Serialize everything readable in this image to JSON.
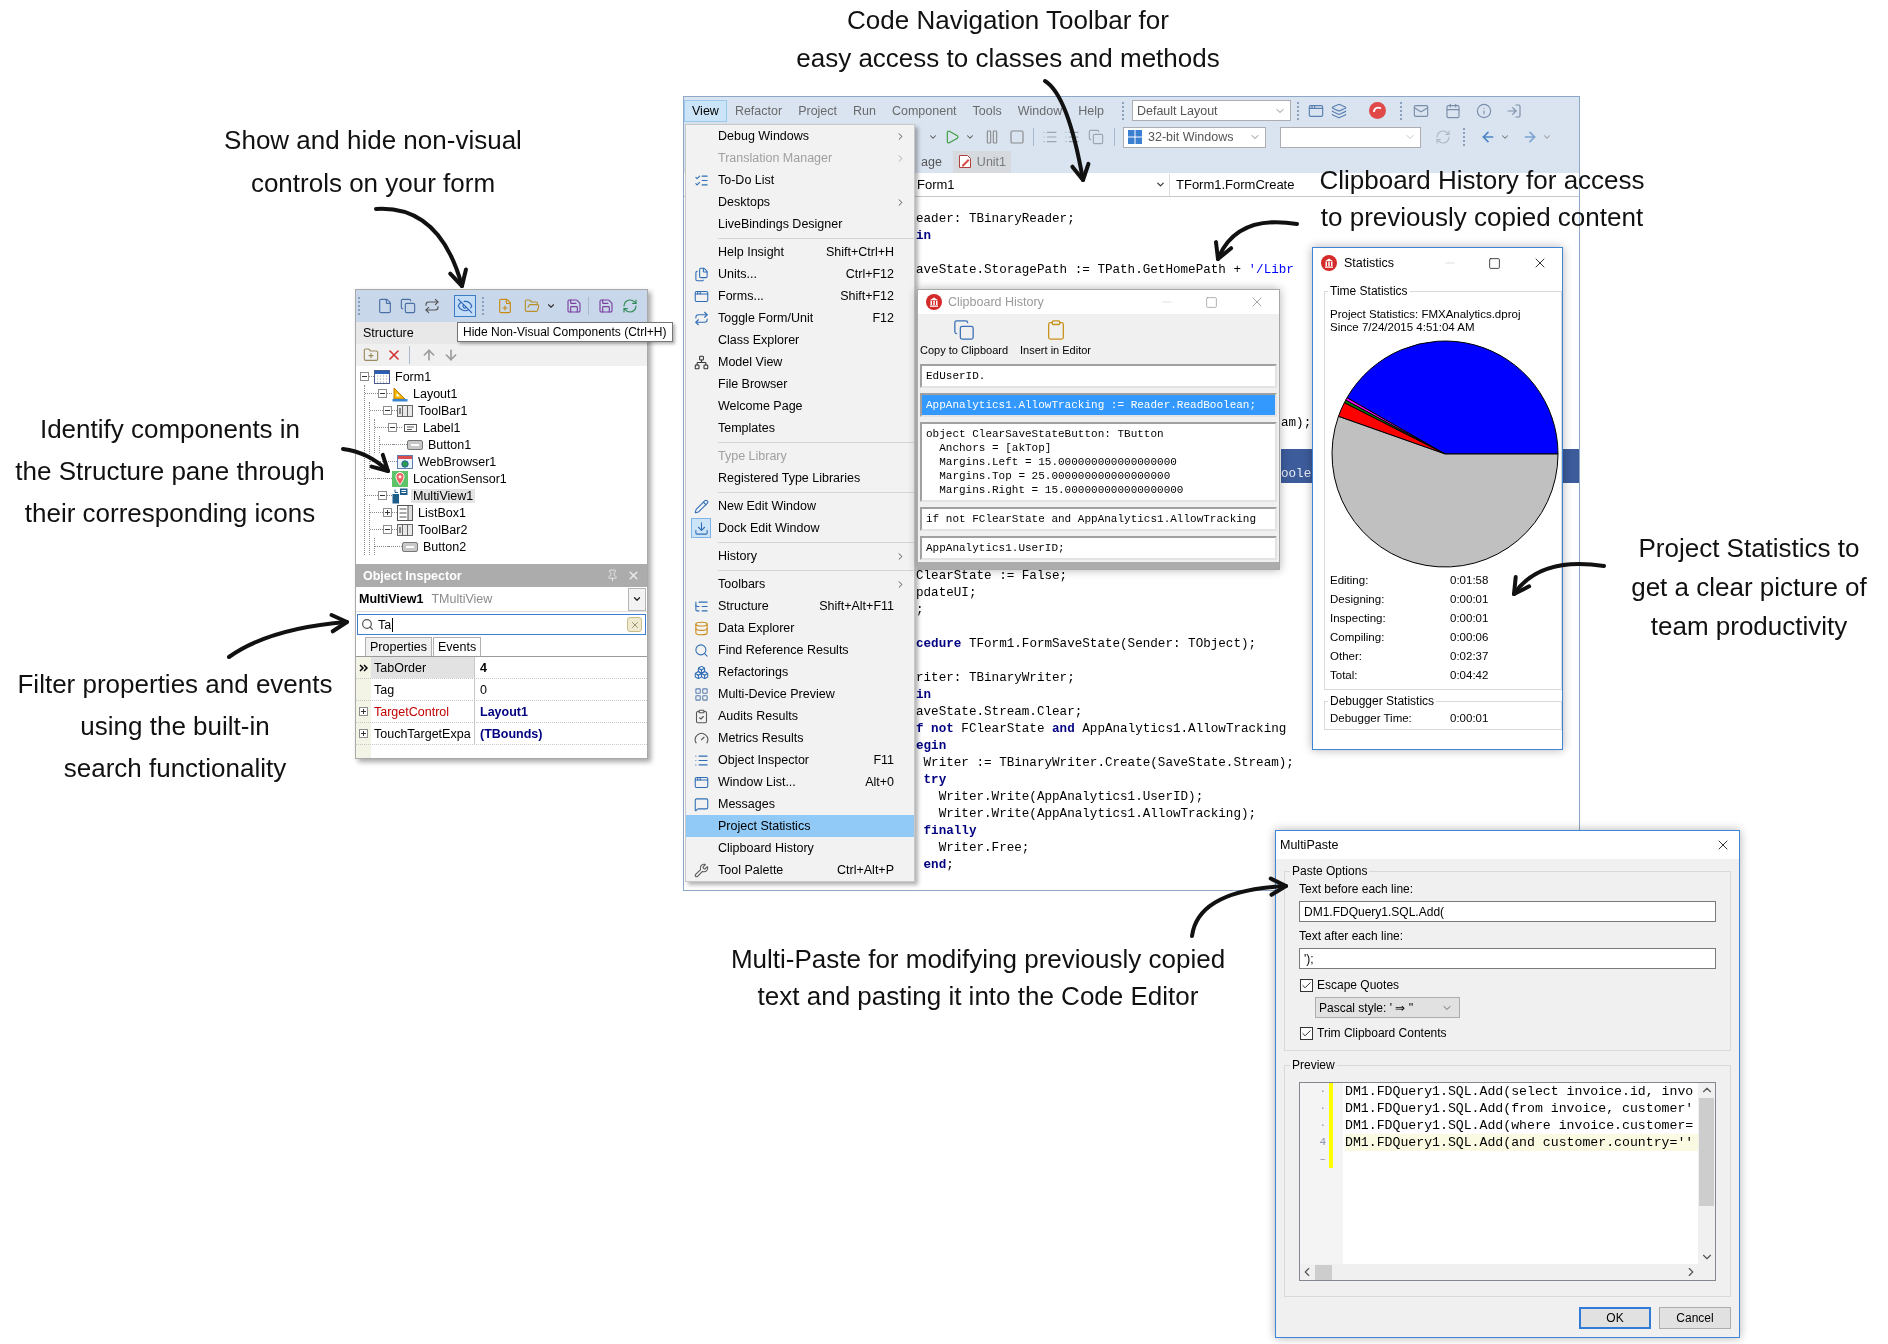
{
  "annotations": [
    {
      "lines": [
        "Code Navigation Toolbar for",
        "easy access to classes and methods"
      ]
    },
    {
      "lines": [
        "Show and hide non-visual",
        "controls on your form"
      ]
    },
    {
      "lines": [
        "Identify components in",
        "the Structure pane through",
        "their corresponding icons"
      ]
    },
    {
      "lines": [
        "Filter properties and events",
        "using the built-in",
        "search functionality"
      ]
    },
    {
      "lines": [
        "Clipboard History for access",
        "to previously copied content"
      ]
    },
    {
      "lines": [
        "Project Statistics to",
        "get a clear picture of",
        "team productivity"
      ]
    },
    {
      "lines": [
        "Multi-Paste for modifying previously copied",
        "text and pasting it into the Code Editor"
      ]
    }
  ],
  "structure_panel": {
    "toolbar_buttons": [
      {
        "pressed": false
      },
      {
        "pressed": false
      },
      {
        "pressed": false
      },
      {
        "pressed": true
      },
      {
        "pressed": false
      },
      {
        "pressed": false
      },
      {
        "pressed": false
      },
      {
        "pressed": false
      },
      {
        "pressed": false
      }
    ],
    "tooltip": "Hide Non-Visual Components (Ctrl+H)",
    "title": "Structure",
    "tree": [
      {
        "label": "Form1",
        "kind": "form",
        "selected": false,
        "expanded": true,
        "children": [
          {
            "label": "Layout1",
            "kind": "layout",
            "selected": false,
            "expanded": true,
            "children": [
              {
                "label": "ToolBar1",
                "kind": "toolbar",
                "selected": false,
                "expanded": true,
                "children": [
                  {
                    "label": "Label1",
                    "kind": "label",
                    "selected": false,
                    "expanded": true,
                    "children": [
                      {
                        "label": "Button1",
                        "kind": "button",
                        "selected": false
                      }
                    ]
                  }
                ]
              },
              {
                "label": "WebBrowser1",
                "kind": "browser",
                "selected": false
              }
            ]
          },
          {
            "label": "LocationSensor1",
            "kind": "sensor",
            "selected": false
          },
          {
            "label": "MultiView1",
            "kind": "multiview",
            "selected": true,
            "expanded": true,
            "children": [
              {
                "label": "ListBox1",
                "kind": "listbox",
                "selected": false,
                "expanded": false
              },
              {
                "label": "ToolBar2",
                "kind": "toolbar",
                "selected": false,
                "expanded": true,
                "children": [
                  {
                    "label": "Button2",
                    "kind": "button",
                    "selected": false
                  }
                ]
              }
            ]
          }
        ]
      }
    ]
  },
  "object_inspector": {
    "title": "Object Inspector",
    "component": "MultiView1",
    "component_type": "TMultiView",
    "search": {
      "value": "Ta"
    },
    "tabs": [
      {
        "label": "Properties",
        "selected": true
      },
      {
        "label": "Events",
        "selected": false
      }
    ],
    "properties": [
      {
        "name": "TabOrder",
        "value": "4",
        "kind": "plain",
        "selected": true,
        "modified": true
      },
      {
        "name": "Tag",
        "value": "0",
        "kind": "plain",
        "selected": false,
        "modified": false
      },
      {
        "name": "TargetControl",
        "value": "Layout1",
        "kind": "reference",
        "selected": false,
        "modified": true
      },
      {
        "name": "TouchTargetExpa",
        "value": "(TBounds)",
        "kind": "object",
        "selected": false,
        "modified": true
      }
    ]
  },
  "ide": {
    "menu_bar": [
      {
        "label": "View",
        "selected": true
      },
      {
        "label": "Refactor",
        "selected": false
      },
      {
        "label": "Project",
        "selected": false
      },
      {
        "label": "Run",
        "selected": false
      },
      {
        "label": "Component",
        "selected": false
      },
      {
        "label": "Tools",
        "selected": false
      },
      {
        "label": "Window",
        "selected": false
      },
      {
        "label": "Help",
        "selected": false
      }
    ],
    "layout_combo": "Default Layout",
    "platform_combo": "32-bit Windows",
    "tabs": [
      {
        "label": "age",
        "selected": false
      },
      {
        "label": "Unit1",
        "selected": true
      }
    ],
    "navigation": {
      "class": "Form1",
      "method": "TForm1.FormCreate"
    },
    "view_menu": [
      {
        "kind": "item",
        "label": "Debug Windows",
        "selected": false,
        "disabled": false,
        "checked": false,
        "submenu": true
      },
      {
        "kind": "item",
        "label": "Translation Manager",
        "selected": false,
        "disabled": true,
        "checked": false,
        "submenu": true
      },
      {
        "kind": "item",
        "label": "To-Do List",
        "selected": false,
        "disabled": false,
        "checked": false,
        "submenu": false
      },
      {
        "kind": "item",
        "label": "Desktops",
        "selected": false,
        "disabled": false,
        "checked": false,
        "submenu": true
      },
      {
        "kind": "item",
        "label": "LiveBindings Designer",
        "selected": false,
        "disabled": false,
        "checked": false,
        "submenu": false
      },
      {
        "kind": "separator"
      },
      {
        "kind": "item",
        "label": "Help Insight",
        "shortcut": "Shift+Ctrl+H",
        "selected": false,
        "disabled": false,
        "checked": false,
        "submenu": false
      },
      {
        "kind": "item",
        "label": "Units...",
        "shortcut": "Ctrl+F12",
        "selected": false,
        "disabled": false,
        "checked": false,
        "submenu": false
      },
      {
        "kind": "item",
        "label": "Forms...",
        "shortcut": "Shift+F12",
        "selected": false,
        "disabled": false,
        "checked": false,
        "submenu": false
      },
      {
        "kind": "item",
        "label": "Toggle Form/Unit",
        "shortcut": "F12",
        "selected": false,
        "disabled": false,
        "checked": false,
        "submenu": false
      },
      {
        "kind": "item",
        "label": "Class Explorer",
        "selected": false,
        "disabled": false,
        "checked": false,
        "submenu": false
      },
      {
        "kind": "item",
        "label": "Model View",
        "selected": false,
        "disabled": false,
        "checked": false,
        "submenu": false
      },
      {
        "kind": "item",
        "label": "File Browser",
        "selected": false,
        "disabled": false,
        "checked": false,
        "submenu": false
      },
      {
        "kind": "item",
        "label": "Welcome Page",
        "selected": false,
        "disabled": false,
        "checked": false,
        "submenu": false
      },
      {
        "kind": "item",
        "label": "Templates",
        "selected": false,
        "disabled": false,
        "checked": false,
        "submenu": false
      },
      {
        "kind": "separator"
      },
      {
        "kind": "item",
        "label": "Type Library",
        "selected": false,
        "disabled": true,
        "checked": false,
        "submenu": false
      },
      {
        "kind": "item",
        "label": "Registered Type Libraries",
        "selected": false,
        "disabled": false,
        "checked": false,
        "submenu": false
      },
      {
        "kind": "separator"
      },
      {
        "kind": "item",
        "label": "New Edit Window",
        "selected": false,
        "disabled": false,
        "checked": false,
        "submenu": false
      },
      {
        "kind": "item",
        "label": "Dock Edit Window",
        "selected": false,
        "disabled": false,
        "checked": true,
        "submenu": false
      },
      {
        "kind": "separator"
      },
      {
        "kind": "item",
        "label": "History",
        "selected": false,
        "disabled": false,
        "checked": false,
        "submenu": true
      },
      {
        "kind": "separator"
      },
      {
        "kind": "item",
        "label": "Toolbars",
        "selected": false,
        "disabled": false,
        "checked": false,
        "submenu": true
      },
      {
        "kind": "item",
        "label": "Structure",
        "shortcut": "Shift+Alt+F11",
        "selected": false,
        "disabled": false,
        "checked": false,
        "submenu": false
      },
      {
        "kind": "item",
        "label": "Data Explorer",
        "selected": false,
        "disabled": false,
        "checked": false,
        "submenu": false
      },
      {
        "kind": "item",
        "label": "Find Reference Results",
        "selected": false,
        "disabled": false,
        "checked": false,
        "submenu": false
      },
      {
        "kind": "item",
        "label": "Refactorings",
        "selected": false,
        "disabled": false,
        "checked": false,
        "submenu": false
      },
      {
        "kind": "item",
        "label": "Multi-Device Preview",
        "selected": false,
        "disabled": false,
        "checked": false,
        "submenu": false
      },
      {
        "kind": "item",
        "label": "Audits Results",
        "selected": false,
        "disabled": false,
        "checked": false,
        "submenu": false
      },
      {
        "kind": "item",
        "label": "Metrics Results",
        "selected": false,
        "disabled": false,
        "checked": false,
        "submenu": false
      },
      {
        "kind": "item",
        "label": "Object Inspector",
        "shortcut": "F11",
        "selected": false,
        "disabled": false,
        "checked": false,
        "submenu": false
      },
      {
        "kind": "item",
        "label": "Window List...",
        "shortcut": "Alt+0",
        "selected": false,
        "disabled": false,
        "checked": false,
        "submenu": false
      },
      {
        "kind": "item",
        "label": "Messages",
        "selected": false,
        "disabled": false,
        "checked": false,
        "submenu": false
      },
      {
        "kind": "item",
        "label": "Project Statistics",
        "selected": true,
        "disabled": false,
        "checked": false,
        "submenu": false
      },
      {
        "kind": "item",
        "label": "Clipboard History",
        "selected": false,
        "disabled": false,
        "checked": false,
        "submenu": false
      },
      {
        "kind": "item",
        "label": "Tool Palette",
        "shortcut": "Ctrl+Alt+P",
        "selected": false,
        "disabled": false,
        "checked": false,
        "submenu": false
      }
    ],
    "code_top": [
      {
        "kind": "code",
        "text": "eader: TBinaryReader;"
      },
      {
        "kind": "code",
        "text": "**in**"
      },
      {
        "kind": "blank"
      },
      {
        "kind": "code",
        "text": "aveState.StoragePath := TPath.GetHomePath + ",
        "string": "'/Libr"
      }
    ],
    "code_beside": [
      {
        "kind": "blank",
        "selected": false
      },
      {
        "kind": "blank",
        "selected": false
      },
      {
        "kind": "blank",
        "selected": false
      },
      {
        "kind": "blank",
        "selected": false
      },
      {
        "kind": "blank",
        "selected": false
      },
      {
        "kind": "blank",
        "selected": false
      },
      {
        "kind": "blank",
        "selected": false
      },
      {
        "kind": "blank",
        "selected": false
      },
      {
        "kind": "code",
        "text": "am);",
        "selected": false
      },
      {
        "kind": "blank",
        "selected": false
      },
      {
        "kind": "blank",
        "selected": true
      },
      {
        "kind": "code",
        "text": "oole",
        "selected": true
      },
      {
        "kind": "blank",
        "selected": false
      },
      {
        "kind": "blank",
        "selected": false
      },
      {
        "kind": "blank",
        "selected": false
      },
      {
        "kind": "blank",
        "selected": false
      },
      {
        "kind": "blank",
        "selected": false
      }
    ],
    "code_bottom": [
      {
        "kind": "code",
        "text": "ClearState := False;"
      },
      {
        "kind": "code",
        "text": "pdateUI;"
      },
      {
        "kind": "code",
        "text": ";"
      },
      {
        "kind": "blank"
      },
      {
        "kind": "code",
        "text": "**cedure** TForm1.FormSaveState(Sender: TObject);"
      },
      {
        "kind": "blank"
      },
      {
        "kind": "code",
        "text": "riter: TBinaryWriter;"
      },
      {
        "kind": "code",
        "text": "**in**"
      },
      {
        "kind": "code",
        "text": "aveState.Stream.Clear;"
      },
      {
        "kind": "code",
        "text": "**f not** FClearState **and** AppAnalytics1.AllowTracking"
      },
      {
        "kind": "code",
        "text": "**egin**"
      },
      {
        "kind": "code",
        "text": " Writer := TBinaryWriter.Create(SaveState.Stream);"
      },
      {
        "kind": "code",
        "text": " **try**"
      },
      {
        "kind": "code",
        "text": "   Writer.Write(AppAnalytics1.UserID);"
      },
      {
        "kind": "code",
        "text": "   Writer.Write(AppAnalytics1.AllowTracking);"
      },
      {
        "kind": "code",
        "text": " **finally**"
      },
      {
        "kind": "code",
        "text": "   Writer.Free;"
      },
      {
        "kind": "code",
        "text": " **end**;"
      }
    ]
  },
  "clipboard_history": {
    "title": "Clipboard History",
    "active": false,
    "toolbar": [
      {
        "label": "Copy to Clipboard"
      },
      {
        "label": "Insert in Editor"
      }
    ],
    "entries": [
      {
        "text": "EdUserID.",
        "selected": false
      },
      {
        "text": "AppAnalytics1.AllowTracking := Reader.ReadBoolean;",
        "selected": true
      },
      {
        "text": "object ClearSaveStateButton: TButton\n  Anchors = [akTop]\n  Margins.Left = 15.000000000000000000\n  Margins.Top = 25.000000000000000000\n  Margins.Right = 15.000000000000000000",
        "selected": false
      },
      {
        "text": "if not FClearState and AppAnalytics1.AllowTracking",
        "selected": false
      },
      {
        "text": "AppAnalytics1.UserID;",
        "selected": false
      }
    ]
  },
  "statistics": {
    "title": "Statistics",
    "active": true,
    "time_group": "Time Statistics",
    "project": "Project Statistics: FMXAnalytics.dproj",
    "since": "Since 7/24/2015 4:51:04 AM",
    "chart_data": {
      "type": "pie",
      "values": [
        41.7,
        0.4,
        0.4,
        2.1,
        55.4
      ]
    },
    "rows": [
      {
        "label": "Editing:",
        "value": "0:01:58"
      },
      {
        "label": "Designing:",
        "value": "0:00:01"
      },
      {
        "label": "Inspecting:",
        "value": "0:00:01"
      },
      {
        "label": "Compiling:",
        "value": "0:00:06"
      },
      {
        "label": "Other:",
        "value": "0:02:37"
      },
      {
        "label": "Total:",
        "value": "0:04:42"
      }
    ],
    "debugger_group": "Debugger Statistics",
    "debugger_rows": [
      {
        "label": "Debugger Time:",
        "value": "0:00:01"
      }
    ]
  },
  "multipaste": {
    "title": "MultiPaste",
    "active": true,
    "options_group": "Paste Options",
    "before_label": "Text before each line:",
    "before_value": "DM1.FDQuery1.SQL.Add(",
    "after_label": "Text after each line:",
    "after_value": "');",
    "escape_quotes": {
      "label": "Escape Quotes",
      "checked": true
    },
    "quote_style": "Pascal style: ' ⇒ ''",
    "trim": {
      "label": "Trim Clipboard Contents",
      "checked": true
    },
    "preview_group": "Preview",
    "gutter": [
      "·",
      "·",
      "·",
      "4",
      "–"
    ],
    "preview_lines": [
      {
        "text": "DM1.FDQuery1.SQL.Add(select invoice.id, invo",
        "current": false
      },
      {
        "text": "DM1.FDQuery1.SQL.Add(from invoice, customer'",
        "current": false
      },
      {
        "text": "DM1.FDQuery1.SQL.Add(where invoice.customer=",
        "current": false
      },
      {
        "text": "DM1.FDQuery1.SQL.Add(and customer.country=''",
        "current": true
      }
    ],
    "buttons": [
      {
        "label": "OK",
        "default": true
      },
      {
        "label": "Cancel",
        "default": false
      }
    ]
  }
}
